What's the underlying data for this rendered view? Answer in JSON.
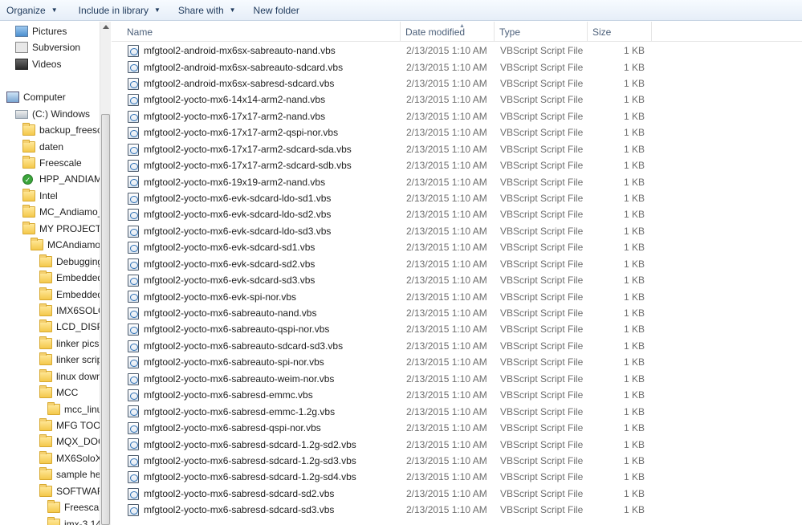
{
  "toolbar": {
    "organize": "Organize",
    "include_in_library": "Include in library",
    "share_with": "Share with",
    "new_folder": "New folder"
  },
  "nav": {
    "items": [
      {
        "label": "Pictures",
        "icon": "pictures-icon"
      },
      {
        "label": "Subversion",
        "icon": "subversion-icon"
      },
      {
        "label": "Videos",
        "icon": "videos-icon"
      },
      {
        "label": "Computer",
        "icon": "computer-icon"
      },
      {
        "label": "(C:) Windows",
        "icon": "drive-icon"
      },
      {
        "label": "backup_freesca",
        "icon": "folder-icon"
      },
      {
        "label": "daten",
        "icon": "folder-icon"
      },
      {
        "label": "Freescale",
        "icon": "folder-icon"
      },
      {
        "label": "HPP_ANDIAMO",
        "icon": "sync-check-icon"
      },
      {
        "label": "Intel",
        "icon": "folder-icon"
      },
      {
        "label": "MC_Andiamo_",
        "icon": "folder-icon"
      },
      {
        "label": "MY PROJECTS",
        "icon": "folder-icon"
      },
      {
        "label": "MCAndiamo",
        "icon": "folder-icon"
      },
      {
        "label": "Debugging",
        "icon": "folder-icon"
      },
      {
        "label": "Embedded",
        "icon": "folder-icon"
      },
      {
        "label": "Embedded",
        "icon": "folder-icon"
      },
      {
        "label": "IMX6SOLO",
        "icon": "folder-icon"
      },
      {
        "label": "LCD_DISPL",
        "icon": "folder-icon"
      },
      {
        "label": "linker pics",
        "icon": "folder-icon"
      },
      {
        "label": "linker scrip",
        "icon": "folder-icon"
      },
      {
        "label": "linux down",
        "icon": "folder-icon"
      },
      {
        "label": "MCC",
        "icon": "folder-icon"
      },
      {
        "label": "mcc_linu",
        "icon": "folder-icon"
      },
      {
        "label": "MFG TOOL",
        "icon": "folder-icon"
      },
      {
        "label": "MQX_DOC",
        "icon": "folder-icon"
      },
      {
        "label": "MX6SoloX",
        "icon": "folder-icon"
      },
      {
        "label": "sample he",
        "icon": "folder-icon"
      },
      {
        "label": "SOFTWAR",
        "icon": "folder-icon"
      },
      {
        "label": "Freescale",
        "icon": "folder-icon"
      },
      {
        "label": "imx-3.14",
        "icon": "folder-icon"
      }
    ]
  },
  "columns": {
    "name": "Name",
    "date_modified": "Date modified",
    "type": "Type",
    "size": "Size"
  },
  "files": [
    {
      "name": "mfgtool2-android-mx6sx-sabreauto-nand.vbs",
      "date": "2/13/2015 1:10 AM",
      "type": "VBScript Script File",
      "size": "1 KB"
    },
    {
      "name": "mfgtool2-android-mx6sx-sabreauto-sdcard.vbs",
      "date": "2/13/2015 1:10 AM",
      "type": "VBScript Script File",
      "size": "1 KB"
    },
    {
      "name": "mfgtool2-android-mx6sx-sabresd-sdcard.vbs",
      "date": "2/13/2015 1:10 AM",
      "type": "VBScript Script File",
      "size": "1 KB"
    },
    {
      "name": "mfgtool2-yocto-mx6-14x14-arm2-nand.vbs",
      "date": "2/13/2015 1:10 AM",
      "type": "VBScript Script File",
      "size": "1 KB"
    },
    {
      "name": "mfgtool2-yocto-mx6-17x17-arm2-nand.vbs",
      "date": "2/13/2015 1:10 AM",
      "type": "VBScript Script File",
      "size": "1 KB"
    },
    {
      "name": "mfgtool2-yocto-mx6-17x17-arm2-qspi-nor.vbs",
      "date": "2/13/2015 1:10 AM",
      "type": "VBScript Script File",
      "size": "1 KB"
    },
    {
      "name": "mfgtool2-yocto-mx6-17x17-arm2-sdcard-sda.vbs",
      "date": "2/13/2015 1:10 AM",
      "type": "VBScript Script File",
      "size": "1 KB"
    },
    {
      "name": "mfgtool2-yocto-mx6-17x17-arm2-sdcard-sdb.vbs",
      "date": "2/13/2015 1:10 AM",
      "type": "VBScript Script File",
      "size": "1 KB"
    },
    {
      "name": "mfgtool2-yocto-mx6-19x19-arm2-nand.vbs",
      "date": "2/13/2015 1:10 AM",
      "type": "VBScript Script File",
      "size": "1 KB"
    },
    {
      "name": "mfgtool2-yocto-mx6-evk-sdcard-ldo-sd1.vbs",
      "date": "2/13/2015 1:10 AM",
      "type": "VBScript Script File",
      "size": "1 KB"
    },
    {
      "name": "mfgtool2-yocto-mx6-evk-sdcard-ldo-sd2.vbs",
      "date": "2/13/2015 1:10 AM",
      "type": "VBScript Script File",
      "size": "1 KB"
    },
    {
      "name": "mfgtool2-yocto-mx6-evk-sdcard-ldo-sd3.vbs",
      "date": "2/13/2015 1:10 AM",
      "type": "VBScript Script File",
      "size": "1 KB"
    },
    {
      "name": "mfgtool2-yocto-mx6-evk-sdcard-sd1.vbs",
      "date": "2/13/2015 1:10 AM",
      "type": "VBScript Script File",
      "size": "1 KB"
    },
    {
      "name": "mfgtool2-yocto-mx6-evk-sdcard-sd2.vbs",
      "date": "2/13/2015 1:10 AM",
      "type": "VBScript Script File",
      "size": "1 KB"
    },
    {
      "name": "mfgtool2-yocto-mx6-evk-sdcard-sd3.vbs",
      "date": "2/13/2015 1:10 AM",
      "type": "VBScript Script File",
      "size": "1 KB"
    },
    {
      "name": "mfgtool2-yocto-mx6-evk-spi-nor.vbs",
      "date": "2/13/2015 1:10 AM",
      "type": "VBScript Script File",
      "size": "1 KB"
    },
    {
      "name": "mfgtool2-yocto-mx6-sabreauto-nand.vbs",
      "date": "2/13/2015 1:10 AM",
      "type": "VBScript Script File",
      "size": "1 KB"
    },
    {
      "name": "mfgtool2-yocto-mx6-sabreauto-qspi-nor.vbs",
      "date": "2/13/2015 1:10 AM",
      "type": "VBScript Script File",
      "size": "1 KB"
    },
    {
      "name": "mfgtool2-yocto-mx6-sabreauto-sdcard-sd3.vbs",
      "date": "2/13/2015 1:10 AM",
      "type": "VBScript Script File",
      "size": "1 KB"
    },
    {
      "name": "mfgtool2-yocto-mx6-sabreauto-spi-nor.vbs",
      "date": "2/13/2015 1:10 AM",
      "type": "VBScript Script File",
      "size": "1 KB"
    },
    {
      "name": "mfgtool2-yocto-mx6-sabreauto-weim-nor.vbs",
      "date": "2/13/2015 1:10 AM",
      "type": "VBScript Script File",
      "size": "1 KB"
    },
    {
      "name": "mfgtool2-yocto-mx6-sabresd-emmc.vbs",
      "date": "2/13/2015 1:10 AM",
      "type": "VBScript Script File",
      "size": "1 KB"
    },
    {
      "name": "mfgtool2-yocto-mx6-sabresd-emmc-1.2g.vbs",
      "date": "2/13/2015 1:10 AM",
      "type": "VBScript Script File",
      "size": "1 KB"
    },
    {
      "name": "mfgtool2-yocto-mx6-sabresd-qspi-nor.vbs",
      "date": "2/13/2015 1:10 AM",
      "type": "VBScript Script File",
      "size": "1 KB"
    },
    {
      "name": "mfgtool2-yocto-mx6-sabresd-sdcard-1.2g-sd2.vbs",
      "date": "2/13/2015 1:10 AM",
      "type": "VBScript Script File",
      "size": "1 KB"
    },
    {
      "name": "mfgtool2-yocto-mx6-sabresd-sdcard-1.2g-sd3.vbs",
      "date": "2/13/2015 1:10 AM",
      "type": "VBScript Script File",
      "size": "1 KB"
    },
    {
      "name": "mfgtool2-yocto-mx6-sabresd-sdcard-1.2g-sd4.vbs",
      "date": "2/13/2015 1:10 AM",
      "type": "VBScript Script File",
      "size": "1 KB"
    },
    {
      "name": "mfgtool2-yocto-mx6-sabresd-sdcard-sd2.vbs",
      "date": "2/13/2015 1:10 AM",
      "type": "VBScript Script File",
      "size": "1 KB"
    },
    {
      "name": "mfgtool2-yocto-mx6-sabresd-sdcard-sd3.vbs",
      "date": "2/13/2015 1:10 AM",
      "type": "VBScript Script File",
      "size": "1 KB"
    }
  ]
}
